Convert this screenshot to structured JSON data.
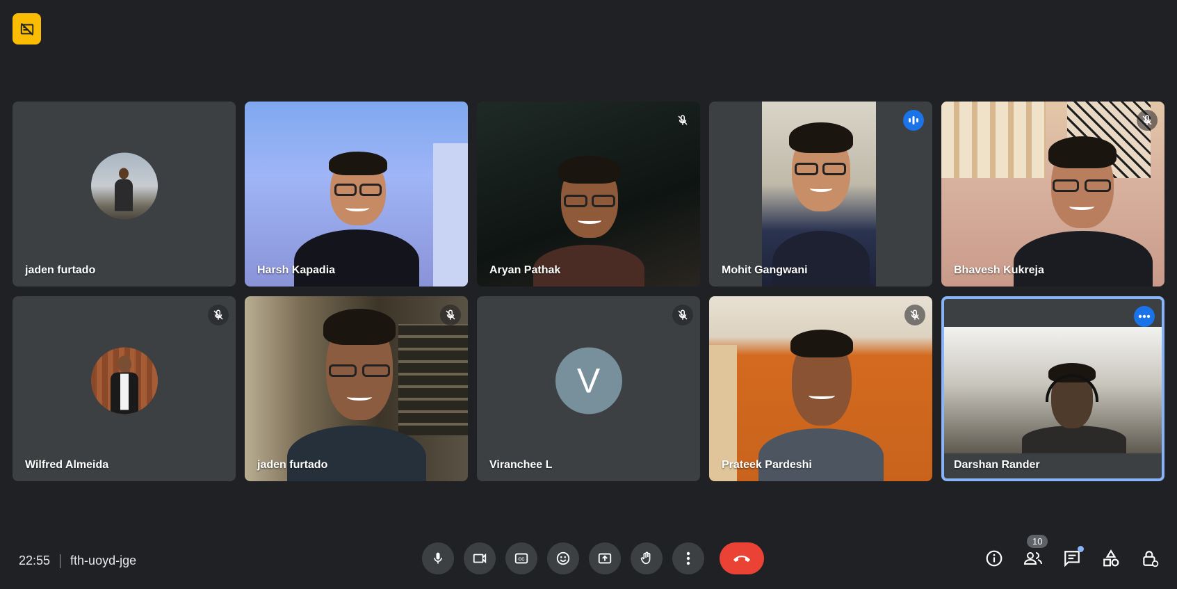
{
  "top_badge": {
    "icon": "no-recording-icon",
    "color": "#fbbc04"
  },
  "participants": [
    {
      "name": "jaden furtado",
      "type": "avatar",
      "muted": false,
      "speaking": false
    },
    {
      "name": "Harsh Kapadia",
      "type": "video",
      "muted": false,
      "speaking": false
    },
    {
      "name": "Aryan Pathak",
      "type": "video",
      "muted": true,
      "speaking": false
    },
    {
      "name": "Mohit Gangwani",
      "type": "video",
      "muted": false,
      "speaking": true
    },
    {
      "name": "Bhavesh Kukreja",
      "type": "video",
      "muted": true,
      "speaking": false
    },
    {
      "name": "Wilfred Almeida",
      "type": "avatar",
      "muted": true,
      "speaking": false
    },
    {
      "name": "jaden furtado",
      "type": "video",
      "muted": true,
      "speaking": false
    },
    {
      "name": "Viranchee L",
      "type": "letter",
      "letter": "V",
      "muted": true,
      "speaking": false
    },
    {
      "name": "Prateek Pardeshi",
      "type": "video",
      "muted": true,
      "speaking": false
    },
    {
      "name": "Darshan Rander",
      "type": "video",
      "muted": false,
      "speaking": false,
      "active": true
    }
  ],
  "footer": {
    "time": "22:55",
    "meeting_code": "fth-uoyd-jge",
    "participant_count": "10"
  },
  "controls": [
    "microphone-icon",
    "camera-icon",
    "captions-icon",
    "emoji-icon",
    "present-icon",
    "raise-hand-icon",
    "more-options-icon",
    "end-call-icon"
  ],
  "right_panel": [
    "info-icon",
    "people-icon",
    "chat-icon",
    "activities-icon",
    "host-controls-icon"
  ],
  "colors": {
    "end_call": "#ea4335",
    "accent": "#8ab4f8",
    "speaking": "#1a73e8"
  }
}
